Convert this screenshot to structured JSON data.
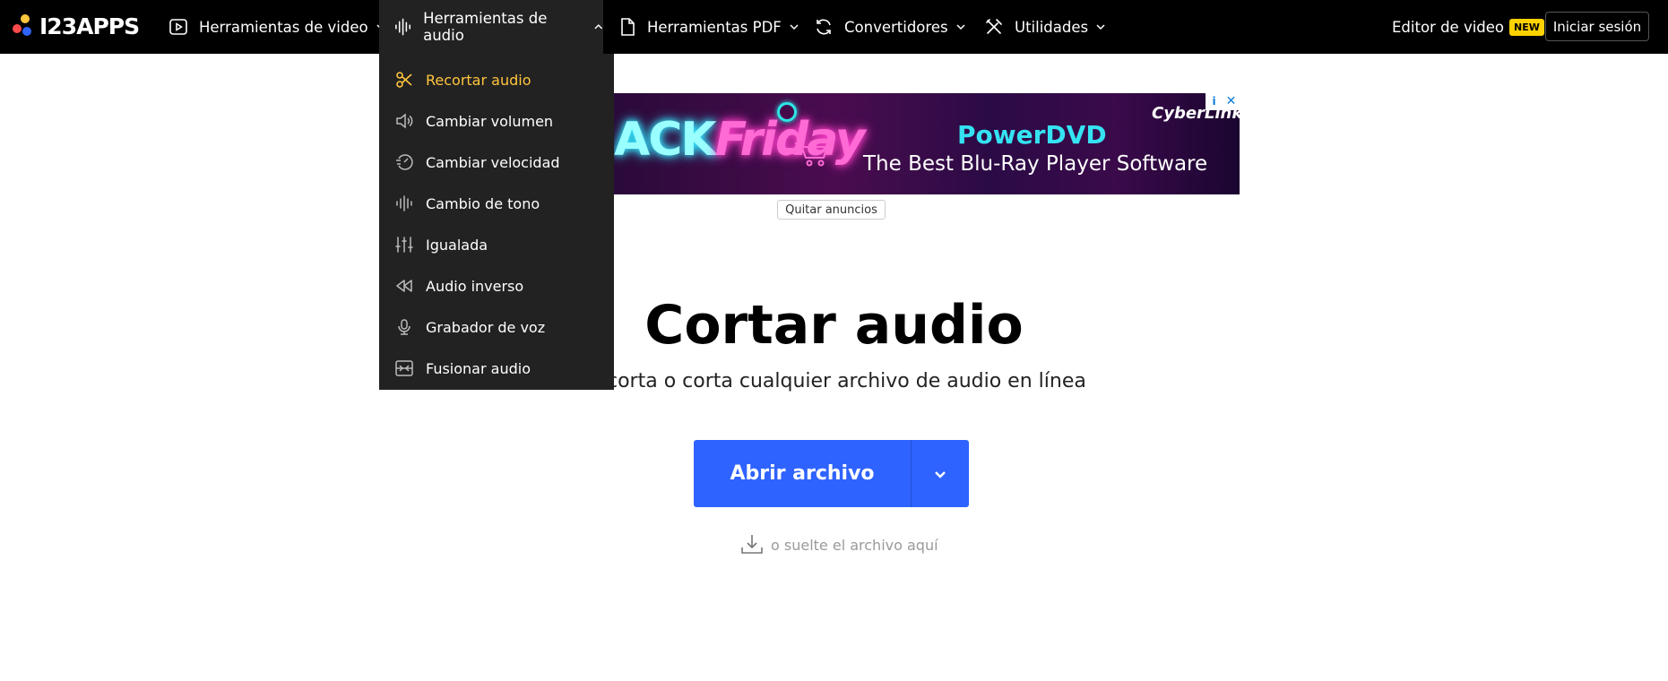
{
  "brand": {
    "logo_text": "I23APPS",
    "dot_colors": [
      "#ff4b4b",
      "#ffc53d",
      "#2f63ff",
      "#29c46a"
    ]
  },
  "nav": {
    "items": [
      {
        "label": "Herramientas de video",
        "icon": "play-square-icon"
      },
      {
        "label": "Herramientas de audio",
        "icon": "waveform-icon",
        "active": true
      },
      {
        "label": "Herramientas PDF",
        "icon": "document-icon"
      },
      {
        "label": "Convertidores",
        "icon": "refresh-icon"
      },
      {
        "label": "Utilidades",
        "icon": "tools-icon"
      }
    ],
    "editor_label": "Editor de video",
    "new_badge": "NEW",
    "login_label": "Iniciar sesión"
  },
  "audio_menu": {
    "items": [
      {
        "label": "Recortar audio",
        "icon": "scissors-icon",
        "selected": true
      },
      {
        "label": "Cambiar volumen",
        "icon": "speaker-icon"
      },
      {
        "label": "Cambiar velocidad",
        "icon": "speed-icon"
      },
      {
        "label": "Cambio de tono",
        "icon": "waveform-icon"
      },
      {
        "label": "Igualada",
        "icon": "equalizer-icon"
      },
      {
        "label": "Audio inverso",
        "icon": "rewind-icon"
      },
      {
        "label": "Grabador de voz",
        "icon": "microphone-icon"
      },
      {
        "label": "Fusionar audio",
        "icon": "merge-icon"
      }
    ]
  },
  "ad": {
    "left_text_a": "ACK",
    "left_text_b": "Friday",
    "product": "PowerDVD",
    "tagline": "The Best Blu-Ray Player Software",
    "brand": "CyberLink",
    "info_glyph": "i",
    "close_glyph": "✕",
    "remove_ads_label": "Quitar anuncios"
  },
  "main": {
    "title": "Cortar audio",
    "subtitle": "Recorta o corta cualquier archivo de audio en línea",
    "open_button_label": "Abrir archivo",
    "drop_hint": "o suelte el archivo aquí"
  },
  "colors": {
    "accent_blue": "#2f63ff",
    "menu_selected": "#ffc53d",
    "topbar": "#000000",
    "dropdown_bg": "#222222"
  }
}
